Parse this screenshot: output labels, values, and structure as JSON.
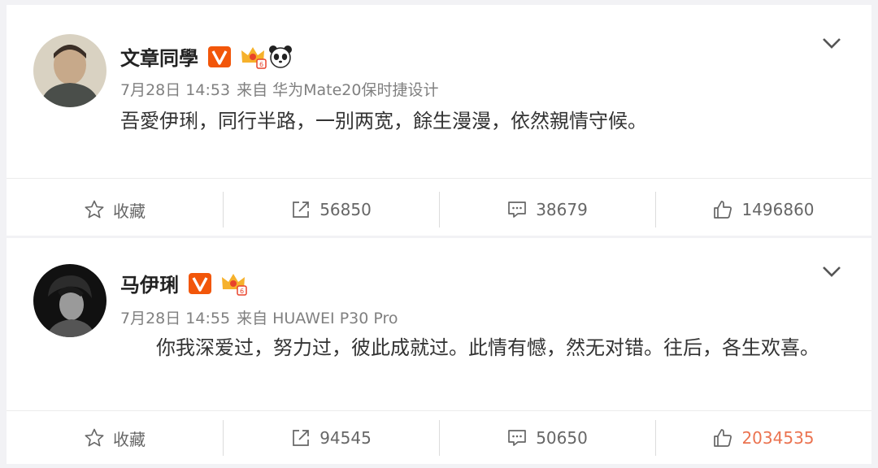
{
  "posts": [
    {
      "author": "文章同學",
      "date": "7月28日 14:53",
      "source": "来自 华为Mate20保时捷设计",
      "content": "吾愛伊琍，同行半路，一别两宽，餘生漫漫，依然親情守候。",
      "actions": {
        "favorite_label": "收藏",
        "repost_count": "56850",
        "comment_count": "38679",
        "like_count": "1496860"
      },
      "liked": false
    },
    {
      "author": "马伊琍",
      "date": "7月28日 14:55",
      "source": "来自 HUAWEI P30 Pro",
      "content": "你我深爱过，努力过，彼此成就过。此情有憾，然无对错。往后，各生欢喜。",
      "actions": {
        "favorite_label": "收藏",
        "repost_count": "94545",
        "comment_count": "50650",
        "like_count": "2034535"
      },
      "liked": true
    }
  ],
  "colors": {
    "verified_badge": "#f2560a",
    "like_active": "#eb7350",
    "meta_text": "#808080",
    "page_bg": "#f2f2f5"
  },
  "icons": {
    "verified": "verified-v-icon",
    "member": "crown-member-icon",
    "panda": "panda-icon",
    "menu": "chevron-down-icon",
    "favorite": "star-icon",
    "repost": "repost-icon",
    "comment": "comment-icon",
    "like": "thumbs-up-icon"
  }
}
